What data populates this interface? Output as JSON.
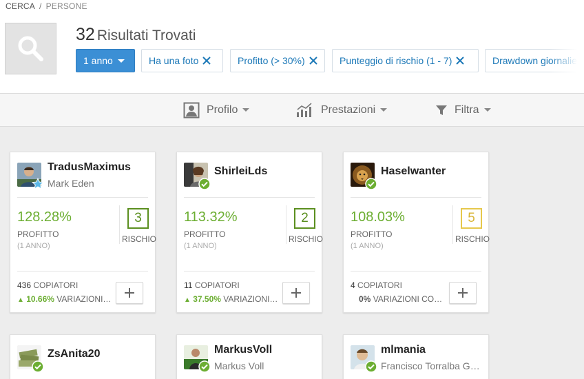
{
  "breadcrumb": {
    "root": "CERCA",
    "separator": "/",
    "current": "PERSONE"
  },
  "results": {
    "count": "32",
    "label": "Risultati Trovati"
  },
  "filters": {
    "period": "1 anno",
    "chips": [
      {
        "label": "Ha una foto"
      },
      {
        "label": "Profitto (> 30%)"
      },
      {
        "label": "Punteggio di rischio (1 - 7)"
      },
      {
        "label": "Drawdown giornaliero"
      }
    ]
  },
  "toolbar": {
    "profile": "Profilo",
    "performance": "Prestazioni",
    "filter": "Filtra"
  },
  "labels": {
    "profit": "PROFITTO",
    "period": "(1 ANNO)",
    "risk": "RISCHIO",
    "copiers": "COPIATORI",
    "changes": "VARIAZIONI COPIATORI"
  },
  "colors": {
    "accent_blue": "#3b8fd5",
    "profit_green": "#6cae32",
    "risk_green": "#5b8f1f",
    "risk_yellow": "#e6c84c"
  },
  "cards": [
    {
      "username": "TradusMaximus",
      "real_name": "Mark Eden",
      "badge": "star-badge",
      "profit": "128.28%",
      "risk": "3",
      "copiers": "436",
      "change": "10.66%",
      "change_dir": "up"
    },
    {
      "username": "ShirleiLds",
      "real_name": "",
      "badge": "verified-badge",
      "profit": "113.32%",
      "risk": "2",
      "copiers": "11",
      "change": "37.50%",
      "change_dir": "up"
    },
    {
      "username": "Haselwanter",
      "real_name": "",
      "badge": "verified-badge",
      "profit": "108.03%",
      "risk": "5",
      "copiers": "4",
      "change": "0%",
      "change_dir": "none"
    },
    {
      "username": "ZsAnita20",
      "real_name": "",
      "badge": "verified-badge"
    },
    {
      "username": "MarkusVoll",
      "real_name": "Markus Voll",
      "badge": "verified-badge"
    },
    {
      "username": "mlmania",
      "real_name": "Francisco Torralba Garcia",
      "badge": "verified-badge"
    }
  ]
}
